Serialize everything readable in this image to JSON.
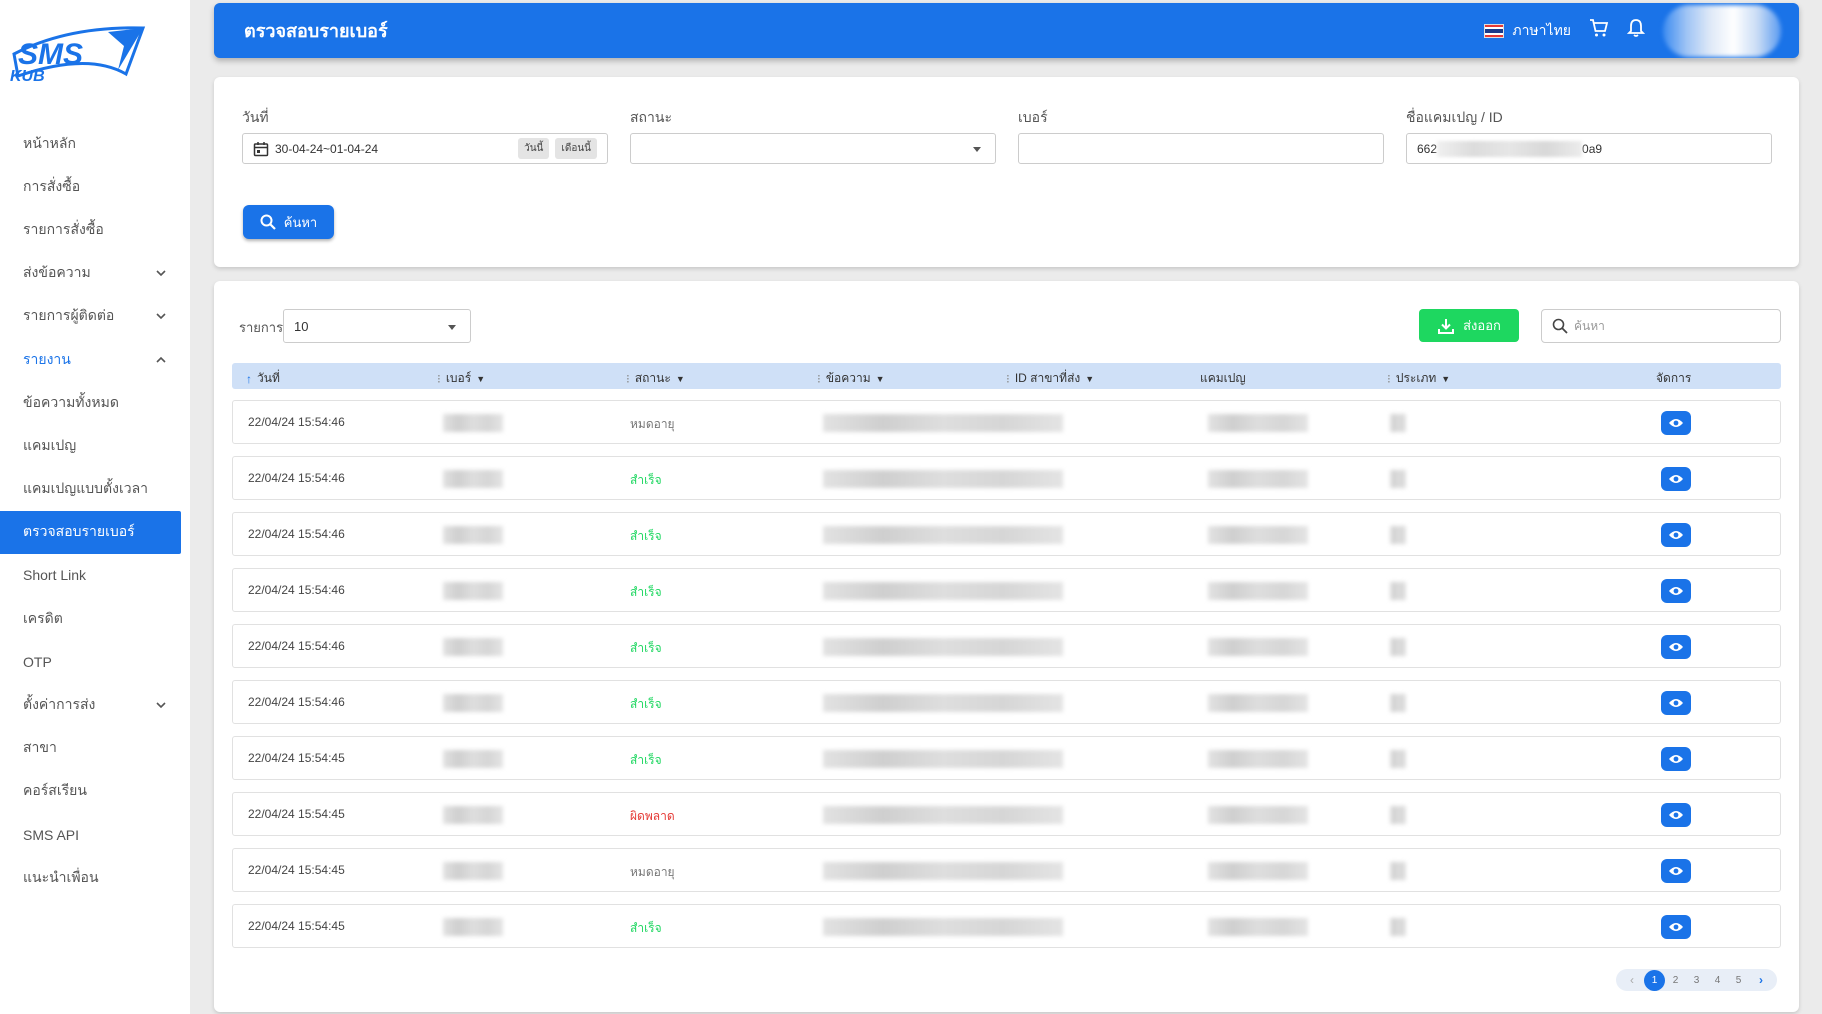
{
  "brand": {
    "logo_text_top": "SMS",
    "logo_text_bottom": "KUB",
    "accent": "#1a73e8"
  },
  "sidebar": {
    "items": [
      {
        "label": "หน้าหลัก"
      },
      {
        "label": "การสั่งซื้อ"
      },
      {
        "label": "รายการสั่งซื้อ"
      },
      {
        "label": "ส่งข้อความ"
      },
      {
        "label": "รายการผู้ติดต่อ"
      },
      {
        "label": "รายงาน"
      },
      {
        "label": "ข้อความทั้งหมด"
      },
      {
        "label": "แคมเปญ"
      },
      {
        "label": "แคมเปญแบบตั้งเวลา"
      },
      {
        "label": "ตรวจสอบรายเบอร์"
      },
      {
        "label": "Short Link"
      },
      {
        "label": "เครดิต"
      },
      {
        "label": "OTP"
      },
      {
        "label": "ตั้งค่าการส่ง"
      },
      {
        "label": "สาขา"
      },
      {
        "label": "คอร์สเรียน"
      },
      {
        "label": "SMS API"
      },
      {
        "label": "แนะนำเพื่อน"
      }
    ]
  },
  "header": {
    "title": "ตรวจสอบรายเบอร์",
    "language": "ภาษาไทย"
  },
  "filters": {
    "date_label": "วันที่",
    "date_value": "30-04-24~01-04-24",
    "today_btn": "วันนี้",
    "month_btn": "เดือนนี้",
    "status_label": "สถานะ",
    "status_value": "",
    "number_label": "เบอร์",
    "number_value": "",
    "campaign_label": "ชื่อแคมเปญ / ID",
    "campaign_value_prefix": "662",
    "campaign_value_suffix": "0a9",
    "search_btn": "ค้นหา"
  },
  "table": {
    "rows_label": "รายการ",
    "rows_value": "10",
    "export_btn": "ส่งออก",
    "search_placeholder": "ค้นหา",
    "headers": {
      "date": "วันที่",
      "number": "เบอร์",
      "status": "สถานะ",
      "message": "ข้อความ",
      "branch_id": "ID สาขาที่ส่ง",
      "campaign": "แคมเปญ",
      "type": "ประเภท",
      "manage": "จัดการ"
    },
    "rows": [
      {
        "date": "22/04/24 15:54:46",
        "status": "หมดอายุ"
      },
      {
        "date": "22/04/24 15:54:46",
        "status": "สำเร็จ"
      },
      {
        "date": "22/04/24 15:54:46",
        "status": "สำเร็จ"
      },
      {
        "date": "22/04/24 15:54:46",
        "status": "สำเร็จ"
      },
      {
        "date": "22/04/24 15:54:46",
        "status": "สำเร็จ"
      },
      {
        "date": "22/04/24 15:54:46",
        "status": "สำเร็จ"
      },
      {
        "date": "22/04/24 15:54:45",
        "status": "สำเร็จ"
      },
      {
        "date": "22/04/24 15:54:45",
        "status": "ผิดพลาด"
      },
      {
        "date": "22/04/24 15:54:45",
        "status": "หมดอายุ"
      },
      {
        "date": "22/04/24 15:54:45",
        "status": "สำเร็จ"
      }
    ]
  },
  "pagination": {
    "pages": [
      "1",
      "2",
      "3",
      "4",
      "5"
    ],
    "current": "1"
  }
}
